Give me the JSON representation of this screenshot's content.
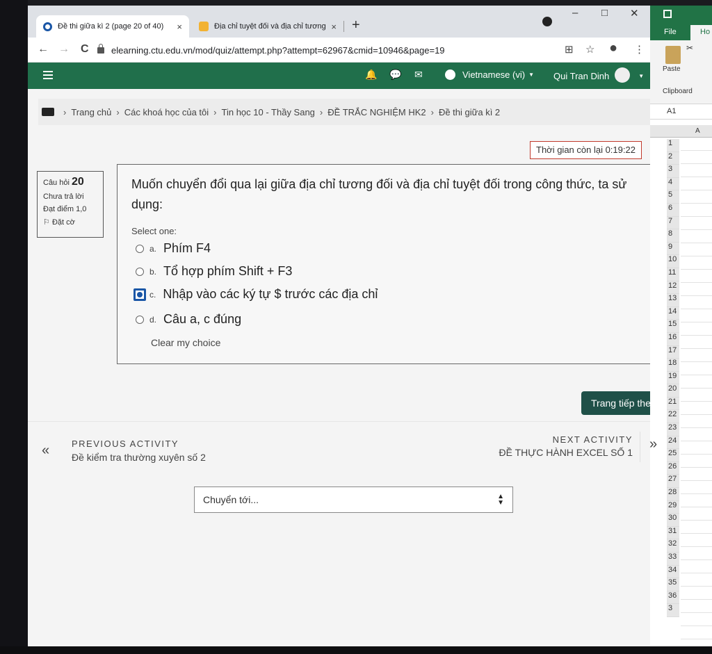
{
  "browser": {
    "tabs": [
      {
        "title": "Đề thi giữa kì 2 (page 20 of 40)",
        "close": "×"
      },
      {
        "title": "Địa chỉ tuyệt đối và địa chỉ tương",
        "close": "×"
      }
    ],
    "new_tab": "+",
    "window_controls": {
      "minimize": "–",
      "maximize": "□",
      "close": "✕"
    },
    "url": "elearning.ctu.edu.vn/mod/quiz/attempt.php?attempt=62967&cmid=10946&page=19",
    "nav": {
      "back": "←",
      "forward": "→",
      "reload": "C"
    },
    "toolbar_icons": {
      "translate": "⊞",
      "star": "☆",
      "account": "●",
      "menu": "⋮"
    }
  },
  "navbar": {
    "icons": {
      "bell": "🔔",
      "chat": "💬",
      "mail": "✉"
    },
    "language": "Vietnamese (vi)",
    "user_name": "Qui Tran Dinh",
    "caret": "▼"
  },
  "breadcrumb": {
    "items": [
      "Trang chủ",
      "Các khoá học của tôi",
      "Tin học 10 - Thầy Sang",
      "ĐỀ TRẮC NGHIỆM HK2",
      "Đề thi giữa kì 2"
    ],
    "separator": "›"
  },
  "timer": {
    "label": "Thời gian còn lại 0:19:22"
  },
  "question_info": {
    "label": "Câu hỏi",
    "number": "20",
    "status": "Chưa trả lời",
    "marks": "Đạt điểm 1,0",
    "flag": "Đặt cờ"
  },
  "question": {
    "text": "Muốn chuyển đổi qua lại giữa địa chỉ tương đối và địa chỉ tuyệt đối trong công thức, ta sử dụng:",
    "select_one": "Select one:",
    "options": [
      {
        "letter": "a.",
        "text": "Phím F4",
        "selected": false
      },
      {
        "letter": "b.",
        "text": "Tổ hợp phím Shift + F3",
        "selected": false
      },
      {
        "letter": "c.",
        "text": "Nhập vào các ký tự $ trước các địa chỉ",
        "selected": true
      },
      {
        "letter": "d.",
        "text": "Câu a, c đúng",
        "selected": false
      }
    ],
    "clear_choice": "Clear my choice"
  },
  "next_page_button": "Trang tiếp theo",
  "activity_nav": {
    "prev_arrow": "«",
    "prev_label": "PREVIOUS ACTIVITY",
    "prev_title": "Đề kiểm tra thường xuyên số 2",
    "next_label": "NEXT ACTIVITY",
    "next_title": "ĐỀ THỰC HÀNH EXCEL SỐ 1",
    "next_arrow": "»"
  },
  "jump_to": {
    "label": "Chuyển tới...",
    "arrows": "▲▼"
  },
  "excel": {
    "file_tab": "File",
    "home_tab": "Ho",
    "paste": "Paste",
    "clipboard": "Clipboard",
    "cut_icon": "✂",
    "name_box": "A1",
    "column": "A",
    "rows": [
      "1",
      "2",
      "3",
      "4",
      "5",
      "6",
      "7",
      "8",
      "9",
      "10",
      "11",
      "12",
      "13",
      "14",
      "15",
      "16",
      "17",
      "18",
      "19",
      "20",
      "21",
      "22",
      "23",
      "24",
      "25",
      "26",
      "27",
      "28",
      "29",
      "30",
      "31",
      "32",
      "33",
      "34",
      "35",
      "36",
      "3"
    ]
  },
  "colors": {
    "navbar": "#206f4b",
    "excel_green": "#217346",
    "timer_border": "#c0392b",
    "next_button": "#1f5048",
    "radio_selected": "#1a56a6"
  }
}
